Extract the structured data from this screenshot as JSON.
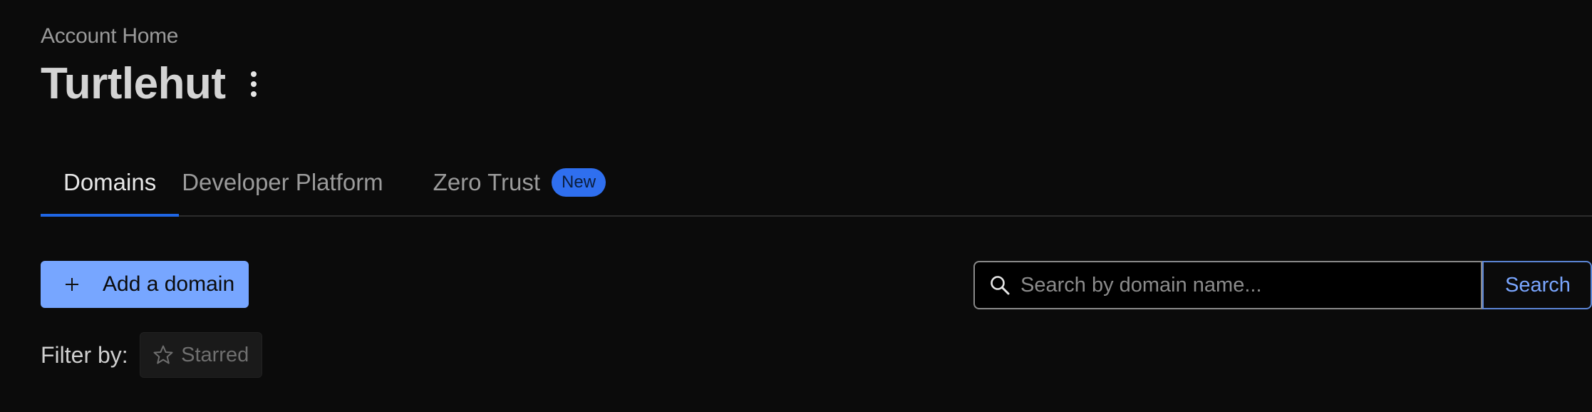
{
  "breadcrumb": "Account Home",
  "account": {
    "title": "Turtlehut",
    "menu_icon": "kebab-menu-icon"
  },
  "tabs": [
    {
      "label": "Domains",
      "active": true
    },
    {
      "label": "Developer Platform",
      "active": false
    },
    {
      "label": "Zero Trust",
      "active": false,
      "badge": "New"
    }
  ],
  "actions": {
    "add_domain_label": "Add a domain",
    "add_icon": "plus-icon"
  },
  "search": {
    "placeholder": "Search by domain name...",
    "value": "",
    "button_label": "Search",
    "icon": "search-icon"
  },
  "filter": {
    "label": "Filter by:",
    "starred_label": "Starred",
    "starred_icon": "star-outline-icon"
  },
  "colors": {
    "background": "#0b0b0b",
    "accent": "#1f66e5",
    "primary_button": "#77a6ff",
    "badge": "#2f6fef",
    "search_button_text": "#7aa6ff"
  }
}
